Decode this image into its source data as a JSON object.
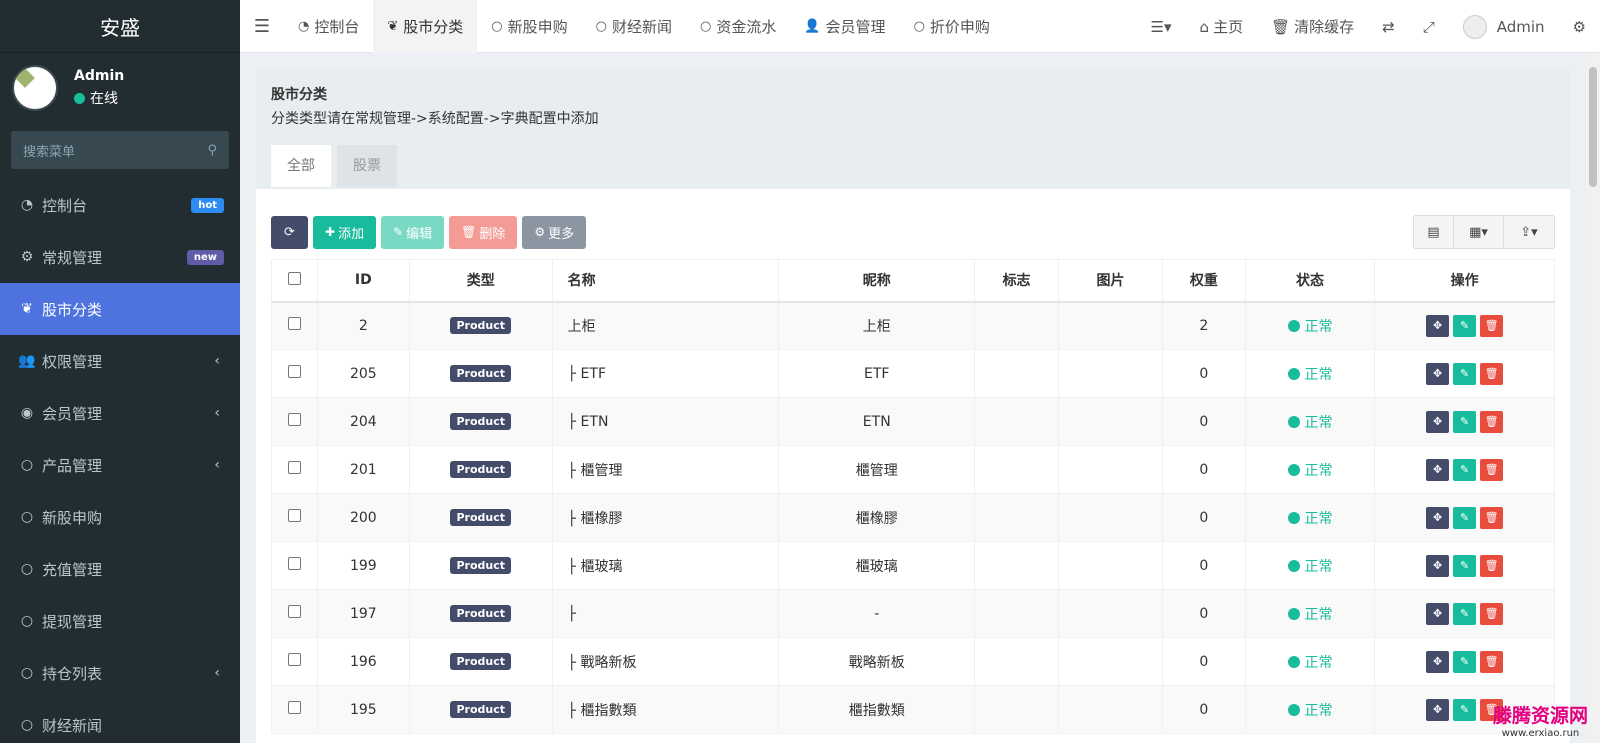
{
  "brand": "安盛",
  "user": {
    "name": "Admin",
    "status": "在线"
  },
  "search": {
    "placeholder": "搜索菜单"
  },
  "menu": [
    {
      "label": "控制台",
      "icon": "dashboard-icon",
      "badge": "hot"
    },
    {
      "label": "常规管理",
      "icon": "cogs-icon",
      "badge": "new"
    },
    {
      "label": "股市分类",
      "icon": "leaf-icon",
      "active": true
    },
    {
      "label": "权限管理",
      "icon": "group-icon",
      "arrow": true
    },
    {
      "label": "会员管理",
      "icon": "user-circle-icon",
      "arrow": true
    },
    {
      "label": "产品管理",
      "icon": "circle-icon",
      "arrow": true
    },
    {
      "label": "新股申购",
      "icon": "circle-icon"
    },
    {
      "label": "充值管理",
      "icon": "circle-icon"
    },
    {
      "label": "提现管理",
      "icon": "circle-icon"
    },
    {
      "label": "持仓列表",
      "icon": "circle-icon",
      "arrow": true
    },
    {
      "label": "财经新闻",
      "icon": "circle-icon"
    }
  ],
  "top_tabs": [
    {
      "label": "控制台",
      "icon": "dashboard-icon"
    },
    {
      "label": "股市分类",
      "icon": "leaf-icon",
      "active": true
    },
    {
      "label": "新股申购",
      "icon": "circle-icon"
    },
    {
      "label": "财经新闻",
      "icon": "circle-icon"
    },
    {
      "label": "资金流水",
      "icon": "circle-icon"
    },
    {
      "label": "会员管理",
      "icon": "user-icon"
    },
    {
      "label": "折价申购",
      "icon": "circle-icon"
    }
  ],
  "top_right": {
    "home": "主页",
    "clear_cache": "清除缓存",
    "admin": "Admin"
  },
  "page": {
    "title": "股市分类",
    "description": "分类类型请在常规管理->系统配置->字典配置中添加",
    "tabs": [
      "全部",
      "股票"
    ]
  },
  "toolbar": {
    "add": "添加",
    "edit": "编辑",
    "delete": "删除",
    "more": "更多"
  },
  "table": {
    "headers": [
      "ID",
      "类型",
      "名称",
      "昵称",
      "标志",
      "图片",
      "权重",
      "状态",
      "操作"
    ],
    "rows": [
      {
        "id": "2",
        "type": "Product",
        "name": "上柜",
        "nickname": "上柜",
        "weight": "2",
        "status": "正常"
      },
      {
        "id": "205",
        "type": "Product",
        "name": "├ ETF",
        "nickname": "ETF",
        "weight": "0",
        "status": "正常"
      },
      {
        "id": "204",
        "type": "Product",
        "name": "├ ETN",
        "nickname": "ETN",
        "weight": "0",
        "status": "正常"
      },
      {
        "id": "201",
        "type": "Product",
        "name": "├ 櫃管理",
        "nickname": "櫃管理",
        "weight": "0",
        "status": "正常"
      },
      {
        "id": "200",
        "type": "Product",
        "name": "├ 櫃橡膠",
        "nickname": "櫃橡膠",
        "weight": "0",
        "status": "正常"
      },
      {
        "id": "199",
        "type": "Product",
        "name": "├ 櫃玻璃",
        "nickname": "櫃玻璃",
        "weight": "0",
        "status": "正常"
      },
      {
        "id": "197",
        "type": "Product",
        "name": "├",
        "nickname": "-",
        "weight": "0",
        "status": "正常"
      },
      {
        "id": "196",
        "type": "Product",
        "name": "├ 戰略新板",
        "nickname": "戰略新板",
        "weight": "0",
        "status": "正常"
      },
      {
        "id": "195",
        "type": "Product",
        "name": "├ 櫃指數類",
        "nickname": "櫃指數類",
        "weight": "0",
        "status": "正常"
      }
    ]
  },
  "watermark": {
    "main": "滕腾资源网",
    "sub": "www.erxiao.run"
  }
}
